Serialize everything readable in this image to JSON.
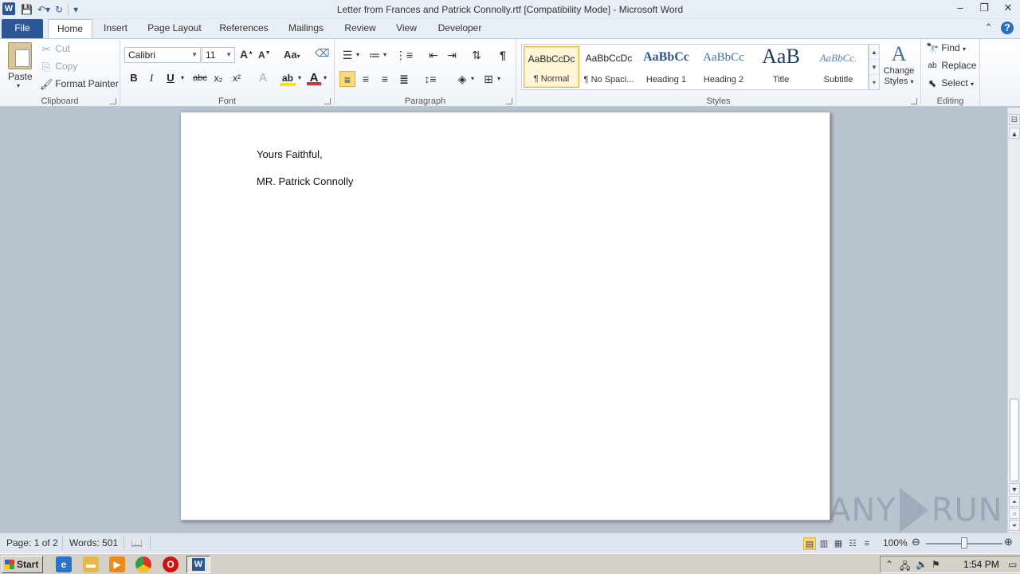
{
  "window": {
    "title": "Letter from Frances and Patrick Connolly.rtf [Compatibility Mode]  -  Microsoft Word",
    "app_icon": "W"
  },
  "tabs": [
    {
      "label": "File"
    },
    {
      "label": "Home"
    },
    {
      "label": "Insert"
    },
    {
      "label": "Page Layout"
    },
    {
      "label": "References"
    },
    {
      "label": "Mailings"
    },
    {
      "label": "Review"
    },
    {
      "label": "View"
    },
    {
      "label": "Developer"
    }
  ],
  "ribbon": {
    "clipboard": {
      "label": "Clipboard",
      "paste": "Paste",
      "cut": "Cut",
      "copy": "Copy",
      "format_painter": "Format Painter"
    },
    "font": {
      "label": "Font",
      "font_name": "Calibri",
      "font_size": "11",
      "bold": "B",
      "italic": "I",
      "underline": "U",
      "strikethrough": "abc",
      "subscript": "x₂",
      "superscript": "x²",
      "grow": "A",
      "shrink": "A",
      "change_case": "Aa",
      "text_effects": "A",
      "font_color": "A",
      "font_color_hex": "#e03030",
      "highlight_hex": "#f5e50a"
    },
    "paragraph": {
      "label": "Paragraph",
      "pilcrow": "¶"
    },
    "styles": {
      "label": "Styles",
      "items": [
        {
          "sample": "AaBbCcDc",
          "name": "¶ Normal"
        },
        {
          "sample": "AaBbCcDc",
          "name": "¶ No Spaci..."
        },
        {
          "sample": "AaBbCc",
          "name": "Heading 1"
        },
        {
          "sample": "AaBbCc",
          "name": "Heading 2"
        },
        {
          "sample": "AaB",
          "name": "Title"
        },
        {
          "sample": "AaBbCc.",
          "name": "Subtitle"
        }
      ],
      "change_styles_line1": "Change",
      "change_styles_line2": "Styles"
    },
    "editing": {
      "label": "Editing",
      "find": "Find",
      "replace": "Replace",
      "select": "Select"
    }
  },
  "document": {
    "lines": [
      "Yours Faithful,",
      "MR. Patrick Connolly"
    ]
  },
  "watermark": {
    "left": "ANY",
    "right": "RUN"
  },
  "statusbar": {
    "page": "Page: 1 of 2",
    "words": "Words: 501",
    "zoom": "100%"
  },
  "taskbar": {
    "start": "Start",
    "clock": "1:54 PM"
  }
}
